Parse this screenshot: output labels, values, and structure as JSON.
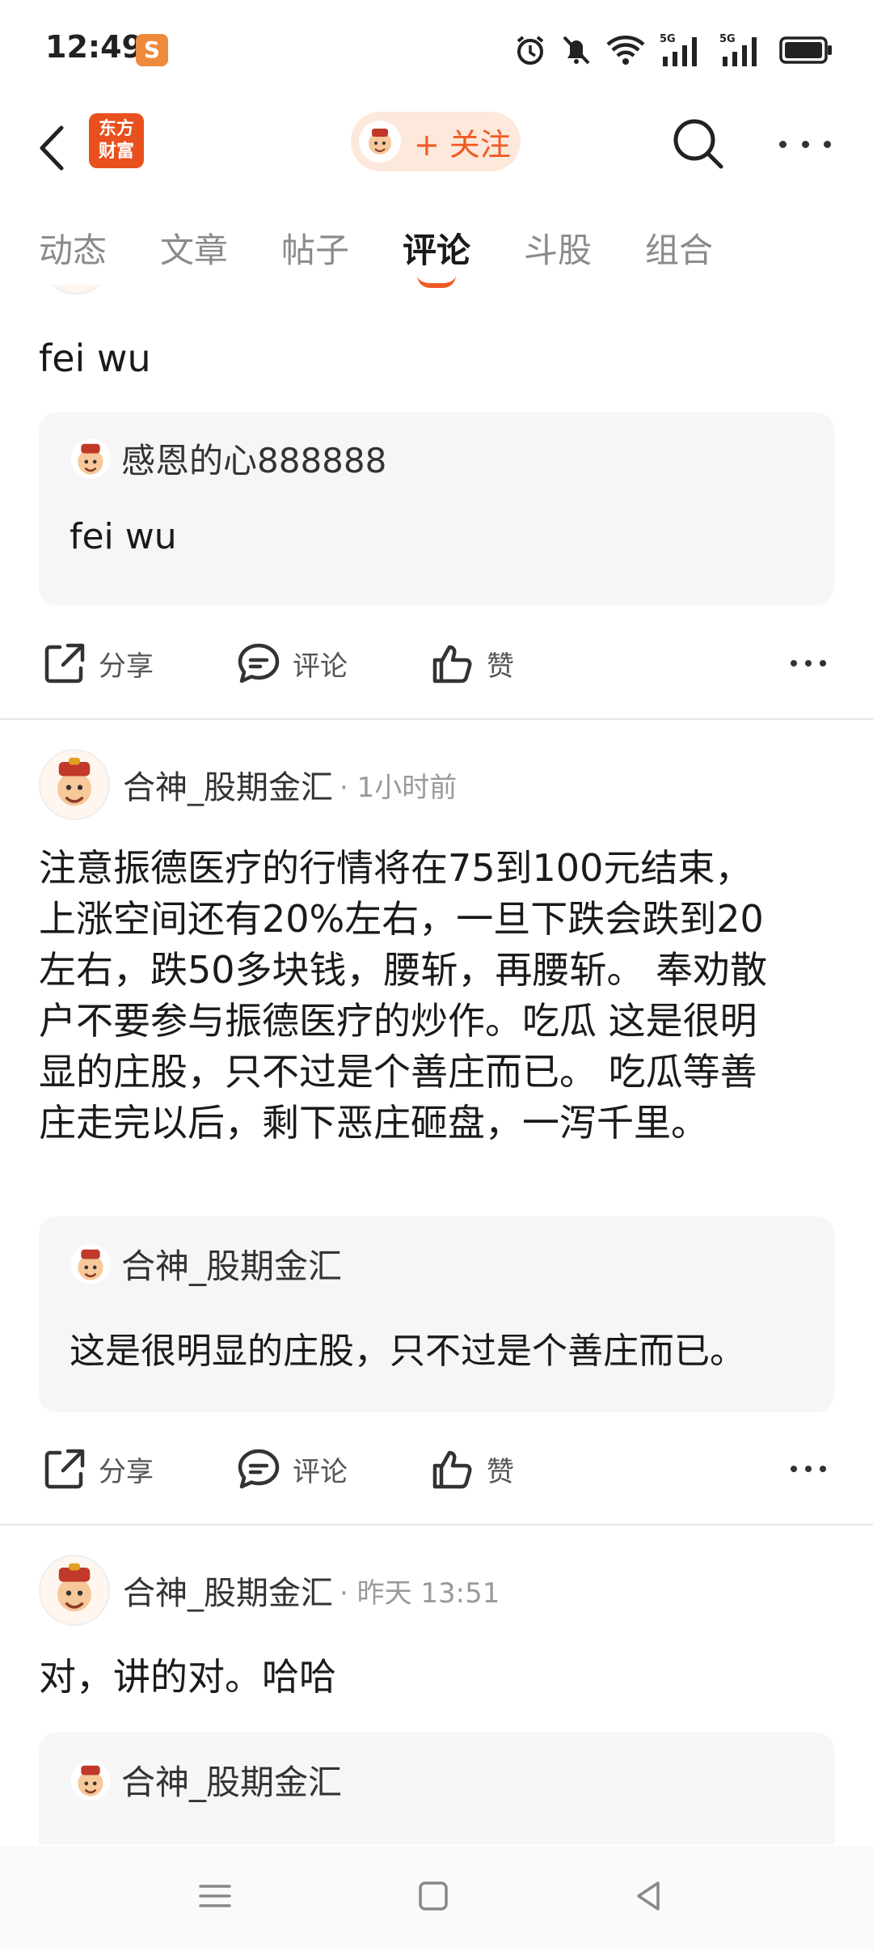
{
  "status_bar": {
    "time": "12:49",
    "app_badge": "S",
    "net1": "5G",
    "net2": "5G"
  },
  "header": {
    "logo_line1": "东方",
    "logo_line2": "财富",
    "follow_label": "+ 关注"
  },
  "tabs": [
    {
      "label": "动态"
    },
    {
      "label": "文章"
    },
    {
      "label": "帖子"
    },
    {
      "label": "评论"
    },
    {
      "label": "斗股"
    },
    {
      "label": "组合"
    }
  ],
  "actions": {
    "share": "分享",
    "comment": "评论",
    "like": "赞"
  },
  "posts": [
    {
      "body": "fei wu",
      "quote": {
        "author": "感恩的心888888",
        "text": "fei wu"
      }
    },
    {
      "author": "合神_股期金汇",
      "time": "· 1小时前",
      "body_lines": [
        "注意振德医疗的行情将在75到100元结束，",
        "上涨空间还有20%左右，一旦下跌会跌到20",
        "左右，跌50多块钱，腰斩，再腰斩。 奉劝散",
        "户不要参与振德医疗的炒作。吃瓜 这是很明",
        "显的庄股，只不过是个善庄而已。 吃瓜等善",
        "庄走完以后，剩下恶庄砸盘，一泻千里。"
      ],
      "quote": {
        "author": "合神_股期金汇",
        "text": "这是很明显的庄股，只不过是个善庄而已。"
      }
    },
    {
      "author": "合神_股期金汇",
      "time": "· 昨天 13:51",
      "body": "对，讲的对。哈哈",
      "quote": {
        "author": "合神_股期金汇"
      }
    }
  ],
  "colors": {
    "accent": "#f05a22",
    "quote_bg": "#f6f6f8",
    "logo_red": "#e8501e"
  }
}
